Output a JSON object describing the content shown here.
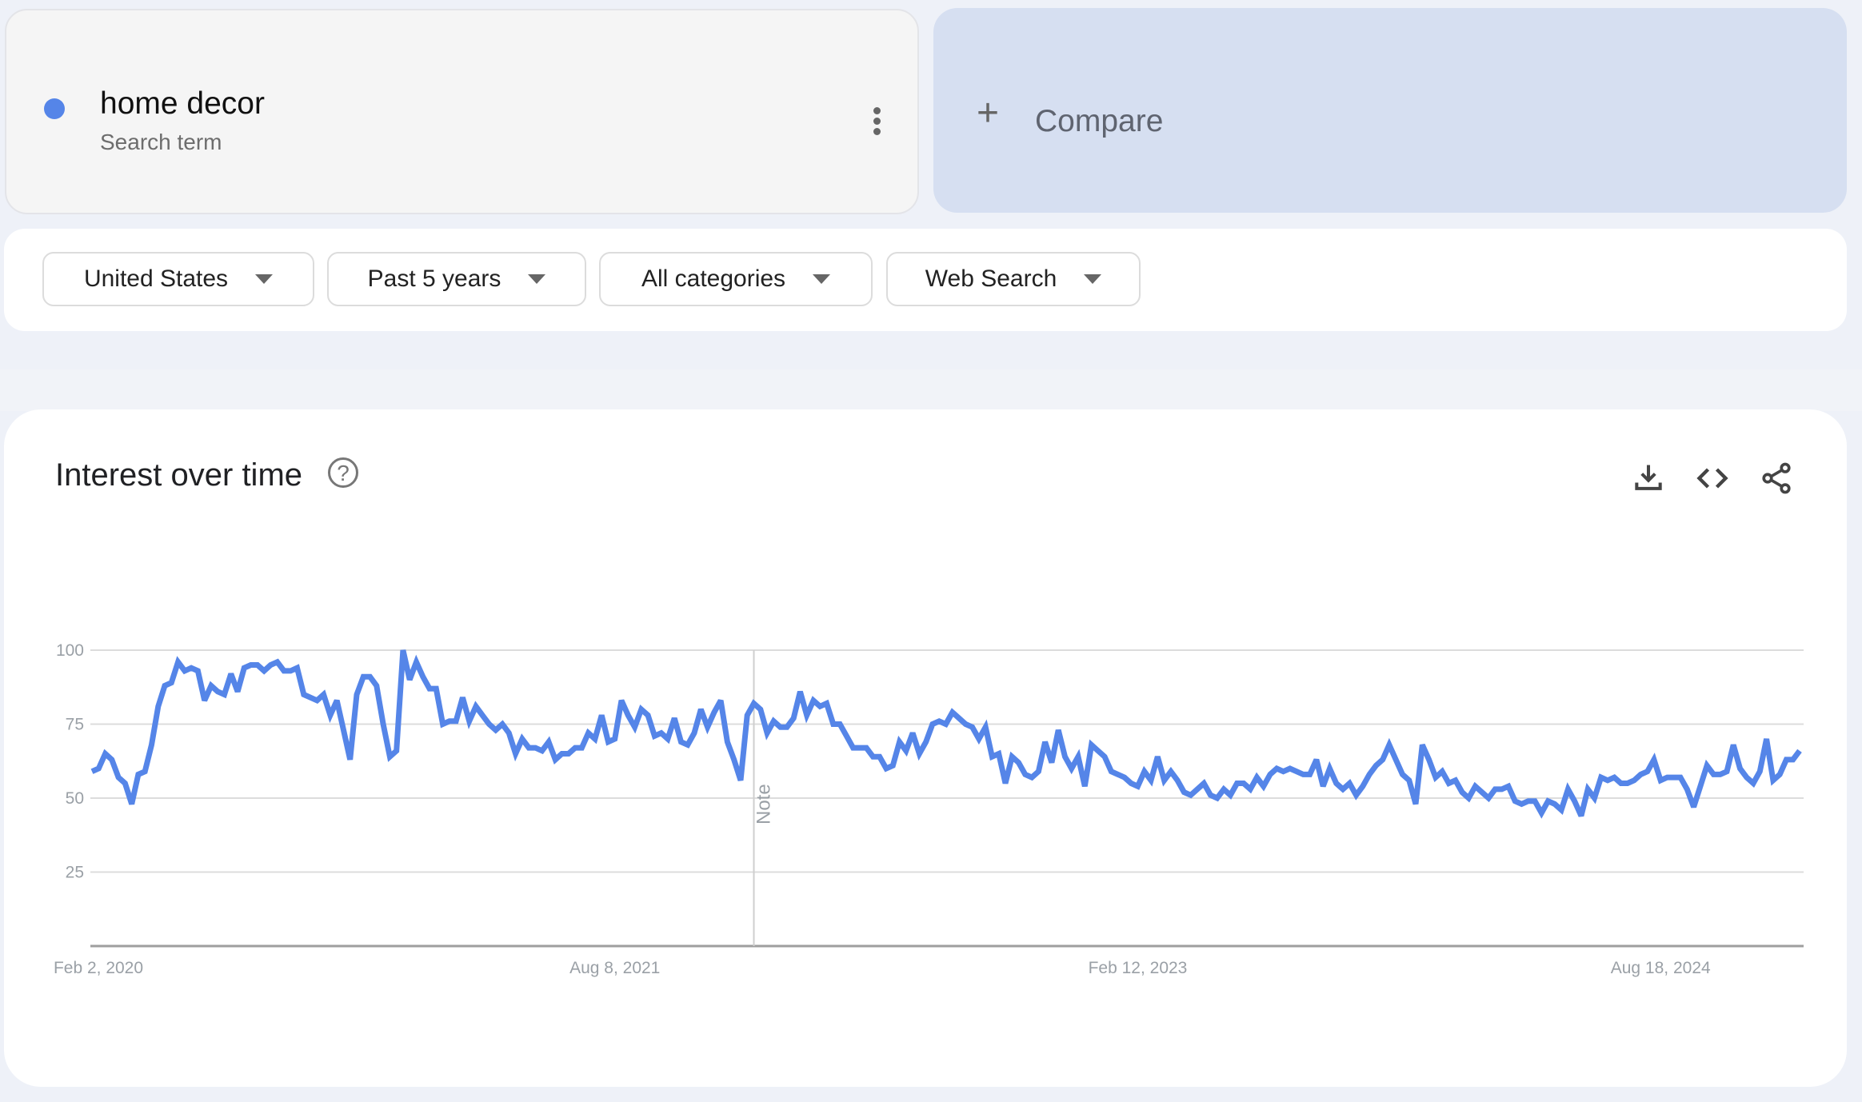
{
  "search_term": {
    "name": "home decor",
    "subtitle": "Search term",
    "color": "#5585e8",
    "more_icon": "more-vert-icon"
  },
  "compare": {
    "label": "Compare",
    "icon": "plus-icon"
  },
  "filters": [
    {
      "label": "United States"
    },
    {
      "label": "Past 5 years"
    },
    {
      "label": "All categories"
    },
    {
      "label": "Web Search"
    }
  ],
  "chart_panel": {
    "title": "Interest over time",
    "help_icon": "help-circle-icon",
    "actions": [
      "download-icon",
      "embed-code-icon",
      "share-icon"
    ]
  },
  "chart_data": {
    "type": "line",
    "title": "Interest over time",
    "xlabel": "",
    "ylabel": "",
    "ylim": [
      0,
      100
    ],
    "yticks": [
      25,
      50,
      75,
      100
    ],
    "ytick_labels": [
      "25",
      "50",
      "75",
      "100"
    ],
    "x_tick_labels": [
      "Feb 2, 2020",
      "Aug 8, 2021",
      "Feb 12, 2023",
      "Aug 18, 2024"
    ],
    "x_tick_positions_week_index": [
      0,
      79,
      158,
      237
    ],
    "grid": true,
    "legend": "none",
    "annotations": [
      {
        "label": "Note",
        "week_index": 100
      }
    ],
    "series": [
      {
        "name": "home decor",
        "color": "#5585e8",
        "values": [
          59,
          60,
          65,
          63,
          57,
          55,
          48,
          58,
          59,
          68,
          81,
          88,
          89,
          96,
          93,
          94,
          93,
          83,
          88,
          86,
          85,
          92,
          86,
          94,
          95,
          95,
          93,
          95,
          96,
          93,
          93,
          94,
          85,
          84,
          83,
          85,
          78,
          83,
          73,
          63,
          85,
          91,
          91,
          88,
          75,
          64,
          66,
          100,
          90,
          96,
          91,
          87,
          87,
          75,
          76,
          76,
          84,
          76,
          81,
          78,
          75,
          73,
          75,
          72,
          65,
          70,
          67,
          67,
          66,
          69,
          63,
          65,
          65,
          67,
          67,
          72,
          70,
          78,
          69,
          70,
          83,
          78,
          74,
          80,
          78,
          71,
          72,
          70,
          77,
          69,
          68,
          72,
          80,
          74,
          79,
          83,
          69,
          63,
          56,
          78,
          82,
          80,
          72,
          76,
          74,
          74,
          77,
          86,
          78,
          83,
          81,
          82,
          75,
          75,
          71,
          67,
          67,
          67,
          64,
          64,
          60,
          61,
          69,
          66,
          72,
          65,
          69,
          75,
          76,
          75,
          79,
          77,
          75,
          74,
          70,
          74,
          64,
          65,
          55,
          64,
          62,
          58,
          57,
          59,
          69,
          62,
          73,
          64,
          60,
          64,
          54,
          68,
          66,
          64,
          59,
          58,
          57,
          55,
          54,
          59,
          56,
          64,
          56,
          59,
          56,
          52,
          51,
          53,
          55,
          51,
          50,
          53,
          51,
          55,
          55,
          53,
          57,
          54,
          58,
          60,
          59,
          60,
          59,
          58,
          58,
          63,
          54,
          60,
          55,
          53,
          55,
          51,
          54,
          58,
          61,
          63,
          68,
          63,
          58,
          56,
          48,
          68,
          63,
          57,
          59,
          55,
          56,
          52,
          50,
          54,
          52,
          50,
          53,
          53,
          54,
          49,
          48,
          49,
          49,
          45,
          49,
          48,
          46,
          53,
          49,
          44,
          53,
          50,
          57,
          56,
          57,
          55,
          55,
          56,
          58,
          59,
          63,
          56,
          57,
          57,
          57,
          53,
          47,
          54,
          61,
          58,
          58,
          59,
          68,
          60,
          57,
          55,
          59,
          70,
          56,
          58,
          63,
          63,
          66
        ]
      }
    ]
  }
}
